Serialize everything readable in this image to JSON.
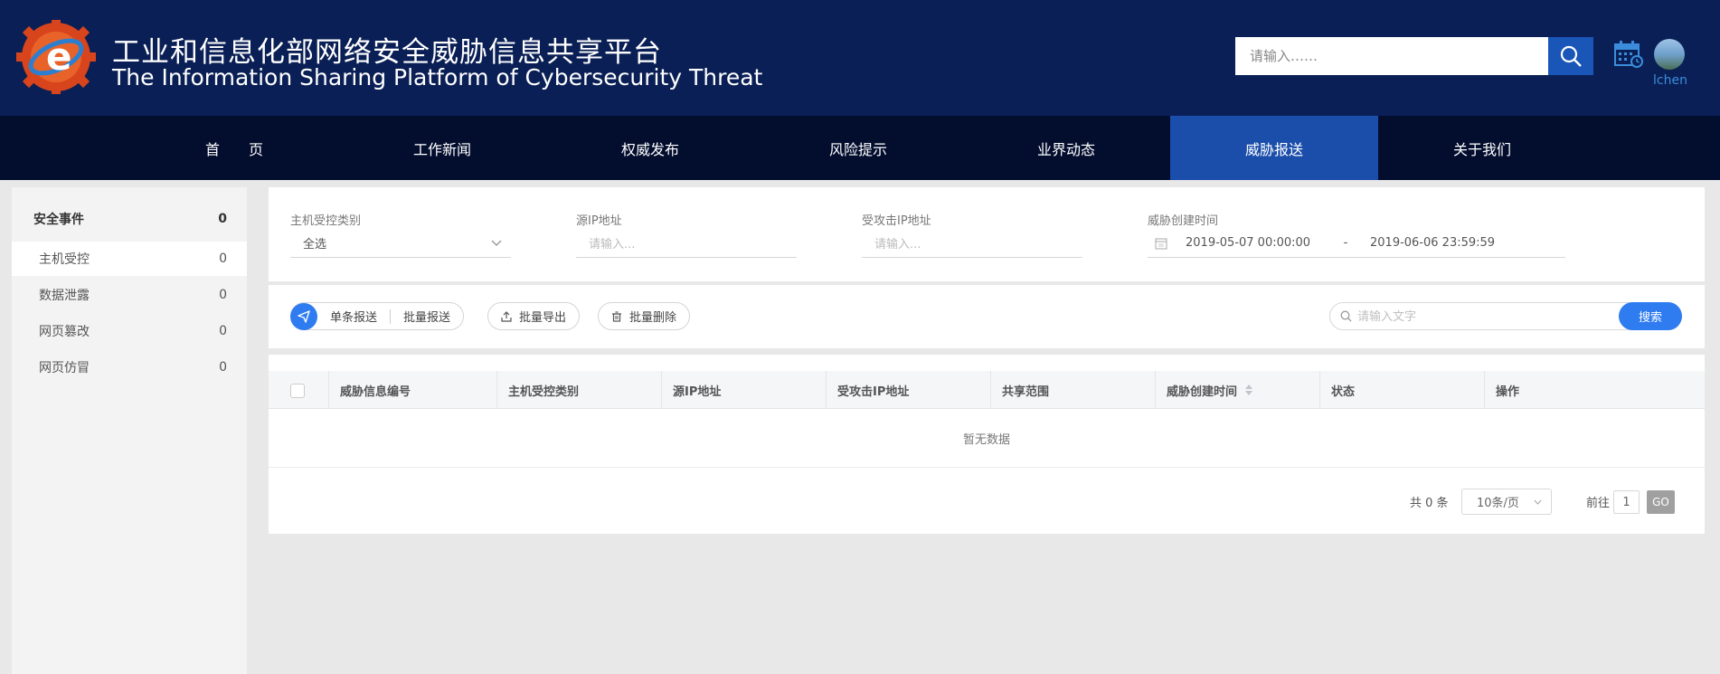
{
  "header": {
    "title_cn": "工业和信息化部网络安全威胁信息共享平台",
    "title_en": "The Information Sharing Platform of Cybersecurity Threat",
    "search_placeholder": "请输入……",
    "username": "lchen"
  },
  "nav": {
    "items": [
      {
        "label": "首　　页"
      },
      {
        "label": "工作新闻"
      },
      {
        "label": "权威发布"
      },
      {
        "label": "风险提示"
      },
      {
        "label": "业界动态"
      },
      {
        "label": "威胁报送",
        "active": true
      },
      {
        "label": "关于我们"
      }
    ]
  },
  "sidebar": {
    "header": {
      "label": "安全事件",
      "count": "0"
    },
    "items": [
      {
        "label": "主机受控",
        "count": "0",
        "active": true
      },
      {
        "label": "数据泄露",
        "count": "0"
      },
      {
        "label": "网页篡改",
        "count": "0"
      },
      {
        "label": "网页仿冒",
        "count": "0"
      }
    ]
  },
  "filter": {
    "host_type_label": "主机受控类别",
    "host_type_value": "全选",
    "src_ip_label": "源IP地址",
    "src_ip_placeholder": "请输入...",
    "target_ip_label": "受攻击IP地址",
    "target_ip_placeholder": "请输入...",
    "time_label": "威胁创建时间",
    "time_start": "2019-05-07 00:00:00",
    "time_sep": "-",
    "time_end": "2019-06-06 23:59:59"
  },
  "toolbar": {
    "single_report": "单条报送",
    "batch_report": "批量报送",
    "batch_export": "批量导出",
    "batch_delete": "批量删除",
    "search_placeholder": "请输入文字",
    "search_btn": "搜索"
  },
  "table": {
    "columns": [
      "威胁信息编号",
      "主机受控类别",
      "源IP地址",
      "受攻击IP地址",
      "共享范围",
      "威胁创建时间",
      "状态",
      "操作"
    ],
    "empty_text": "暂无数据"
  },
  "pagination": {
    "total": "共 0 条",
    "page_size": "10条/页",
    "goto_label": "前往",
    "page": "1",
    "go": "GO"
  },
  "colors": {
    "header_bg": "#0a1f55",
    "nav_bg": "#030d2e",
    "nav_active": "#1b4eab",
    "primary": "#2f7cf0"
  }
}
